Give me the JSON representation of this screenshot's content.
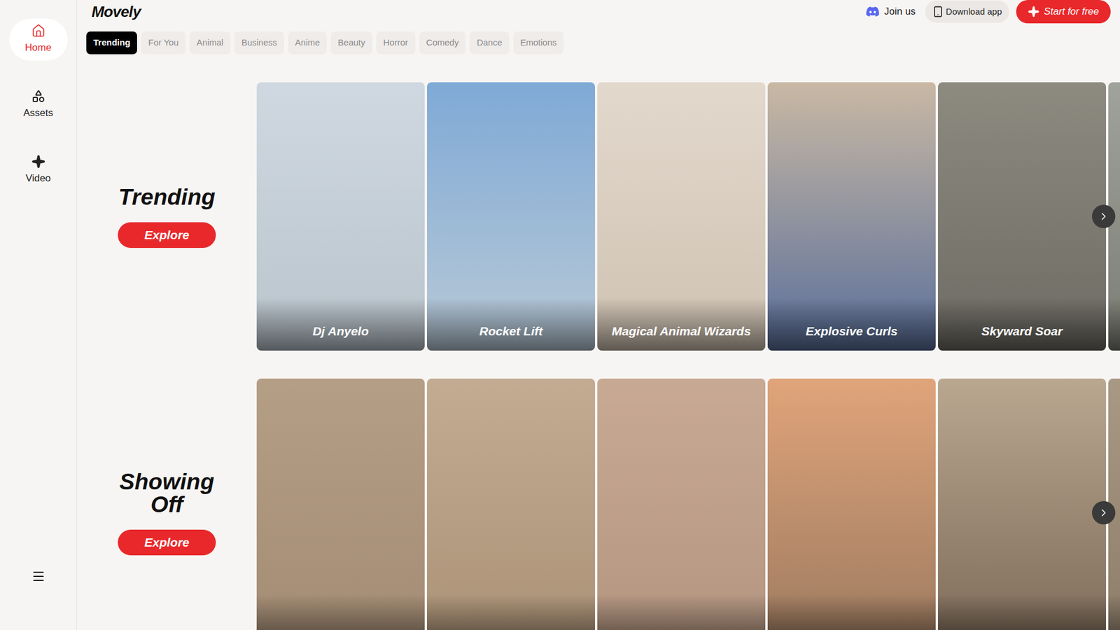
{
  "header": {
    "logo": "Movely",
    "join": "Join us",
    "download": "Download app",
    "start": "Start for free"
  },
  "sidebar": {
    "items": [
      {
        "label": "Home",
        "icon": "home",
        "selected": true
      },
      {
        "label": "Assets",
        "icon": "assets",
        "selected": false
      },
      {
        "label": "Video",
        "icon": "video",
        "selected": false
      }
    ]
  },
  "categories": [
    {
      "label": "Trending",
      "selected": true
    },
    {
      "label": "For You",
      "selected": false
    },
    {
      "label": "Animal",
      "selected": false
    },
    {
      "label": "Business",
      "selected": false
    },
    {
      "label": "Anime",
      "selected": false
    },
    {
      "label": "Beauty",
      "selected": false
    },
    {
      "label": "Horror",
      "selected": false
    },
    {
      "label": "Comedy",
      "selected": false
    },
    {
      "label": "Dance",
      "selected": false
    },
    {
      "label": "Emotions",
      "selected": false
    }
  ],
  "sections": [
    {
      "title": "Trending",
      "button": "Explore",
      "cards": [
        {
          "label": "Dj Anyelo"
        },
        {
          "label": "Rocket Lift"
        },
        {
          "label": "Magical Animal Wizards"
        },
        {
          "label": "Explosive Curls"
        },
        {
          "label": "Skyward Soar"
        },
        {
          "label": ""
        }
      ]
    },
    {
      "title": "Showing Off",
      "button": "Explore",
      "cards": [
        {
          "label": ""
        },
        {
          "label": ""
        },
        {
          "label": ""
        },
        {
          "label": ""
        },
        {
          "label": ""
        },
        {
          "label": ""
        }
      ]
    }
  ]
}
